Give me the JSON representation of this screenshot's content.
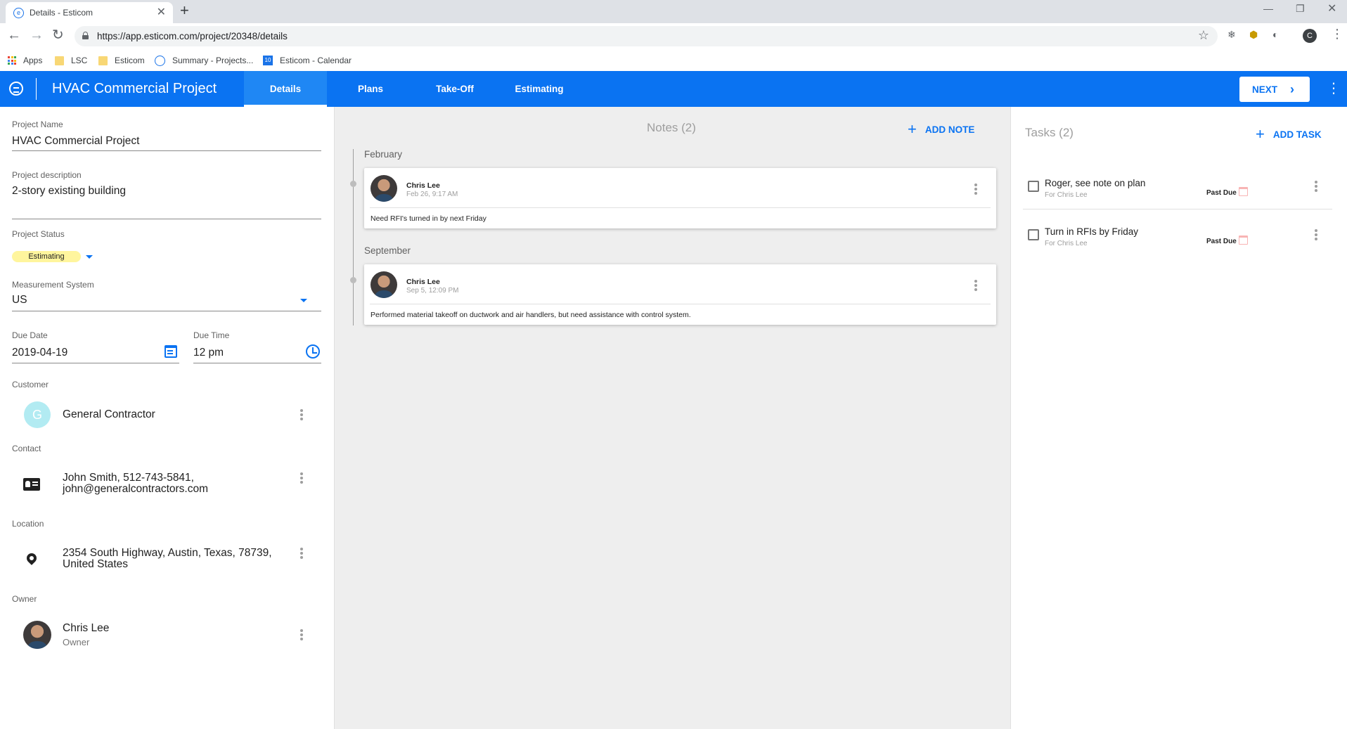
{
  "browser": {
    "tab_title": "Details - Esticom",
    "tab_close": "✕",
    "new_tab": "+",
    "url": "https://app.esticom.com/project/20348/details",
    "profile_initial": "C",
    "bookmarks": [
      {
        "label": "Apps",
        "icon": "apps-grid-icon"
      },
      {
        "label": "LSC",
        "icon": "folder-icon"
      },
      {
        "label": "Esticom",
        "icon": "folder-icon"
      },
      {
        "label": "Summary - Projects...",
        "icon": "esticom-favicon"
      },
      {
        "label": "Esticom - Calendar",
        "icon": "calendar-favicon",
        "badge": "10"
      }
    ]
  },
  "appbar": {
    "title": "HVAC Commercial Project",
    "tabs": [
      {
        "label": "Details",
        "active": true
      },
      {
        "label": "Plans",
        "active": false
      },
      {
        "label": "Take-Off",
        "active": false
      },
      {
        "label": "Estimating",
        "active": false
      }
    ],
    "next_label": "NEXT",
    "accent": "#0a73f2"
  },
  "details": {
    "project_name_label": "Project Name",
    "project_name": "HVAC Commercial Project",
    "description_label": "Project description",
    "description": "2-story existing building",
    "status_label": "Project Status",
    "status": "Estimating",
    "status_color": "#fff59d",
    "measurement_label": "Measurement System",
    "measurement": "US",
    "due_date_label": "Due Date",
    "due_date": "2019-04-19",
    "due_time_label": "Due Time",
    "due_time": "12 pm",
    "customer_label": "Customer",
    "customer_initial": "G",
    "customer": "General Contractor",
    "contact_label": "Contact",
    "contact_line1": "John Smith, 512-743-5841,",
    "contact_line2": "john@generalcontractors.com",
    "location_label": "Location",
    "location_line1": "2354 South Highway, Austin, Texas, 78739,",
    "location_line2": "United States",
    "owner_label": "Owner",
    "owner_name": "Chris Lee",
    "owner_role": "Owner"
  },
  "notes": {
    "title": "Notes (2)",
    "add_label": "ADD NOTE",
    "items": [
      {
        "month": "February",
        "author": "Chris Lee",
        "time": "Feb 26, 9:17 AM",
        "body": "Need RFI's turned in by next Friday"
      },
      {
        "month": "September",
        "author": "Chris Lee",
        "time": "Sep 5, 12:09 PM",
        "body": "Performed material takeoff on ductwork and air handlers, but need assistance with control system."
      }
    ]
  },
  "tasks": {
    "title": "Tasks (2)",
    "add_label": "ADD TASK",
    "items": [
      {
        "title": "Roger, see note on plan",
        "for": "For Chris Lee",
        "status": "Past Due"
      },
      {
        "title": "Turn in RFIs by Friday",
        "for": "For Chris Lee",
        "status": "Past Due"
      }
    ]
  }
}
